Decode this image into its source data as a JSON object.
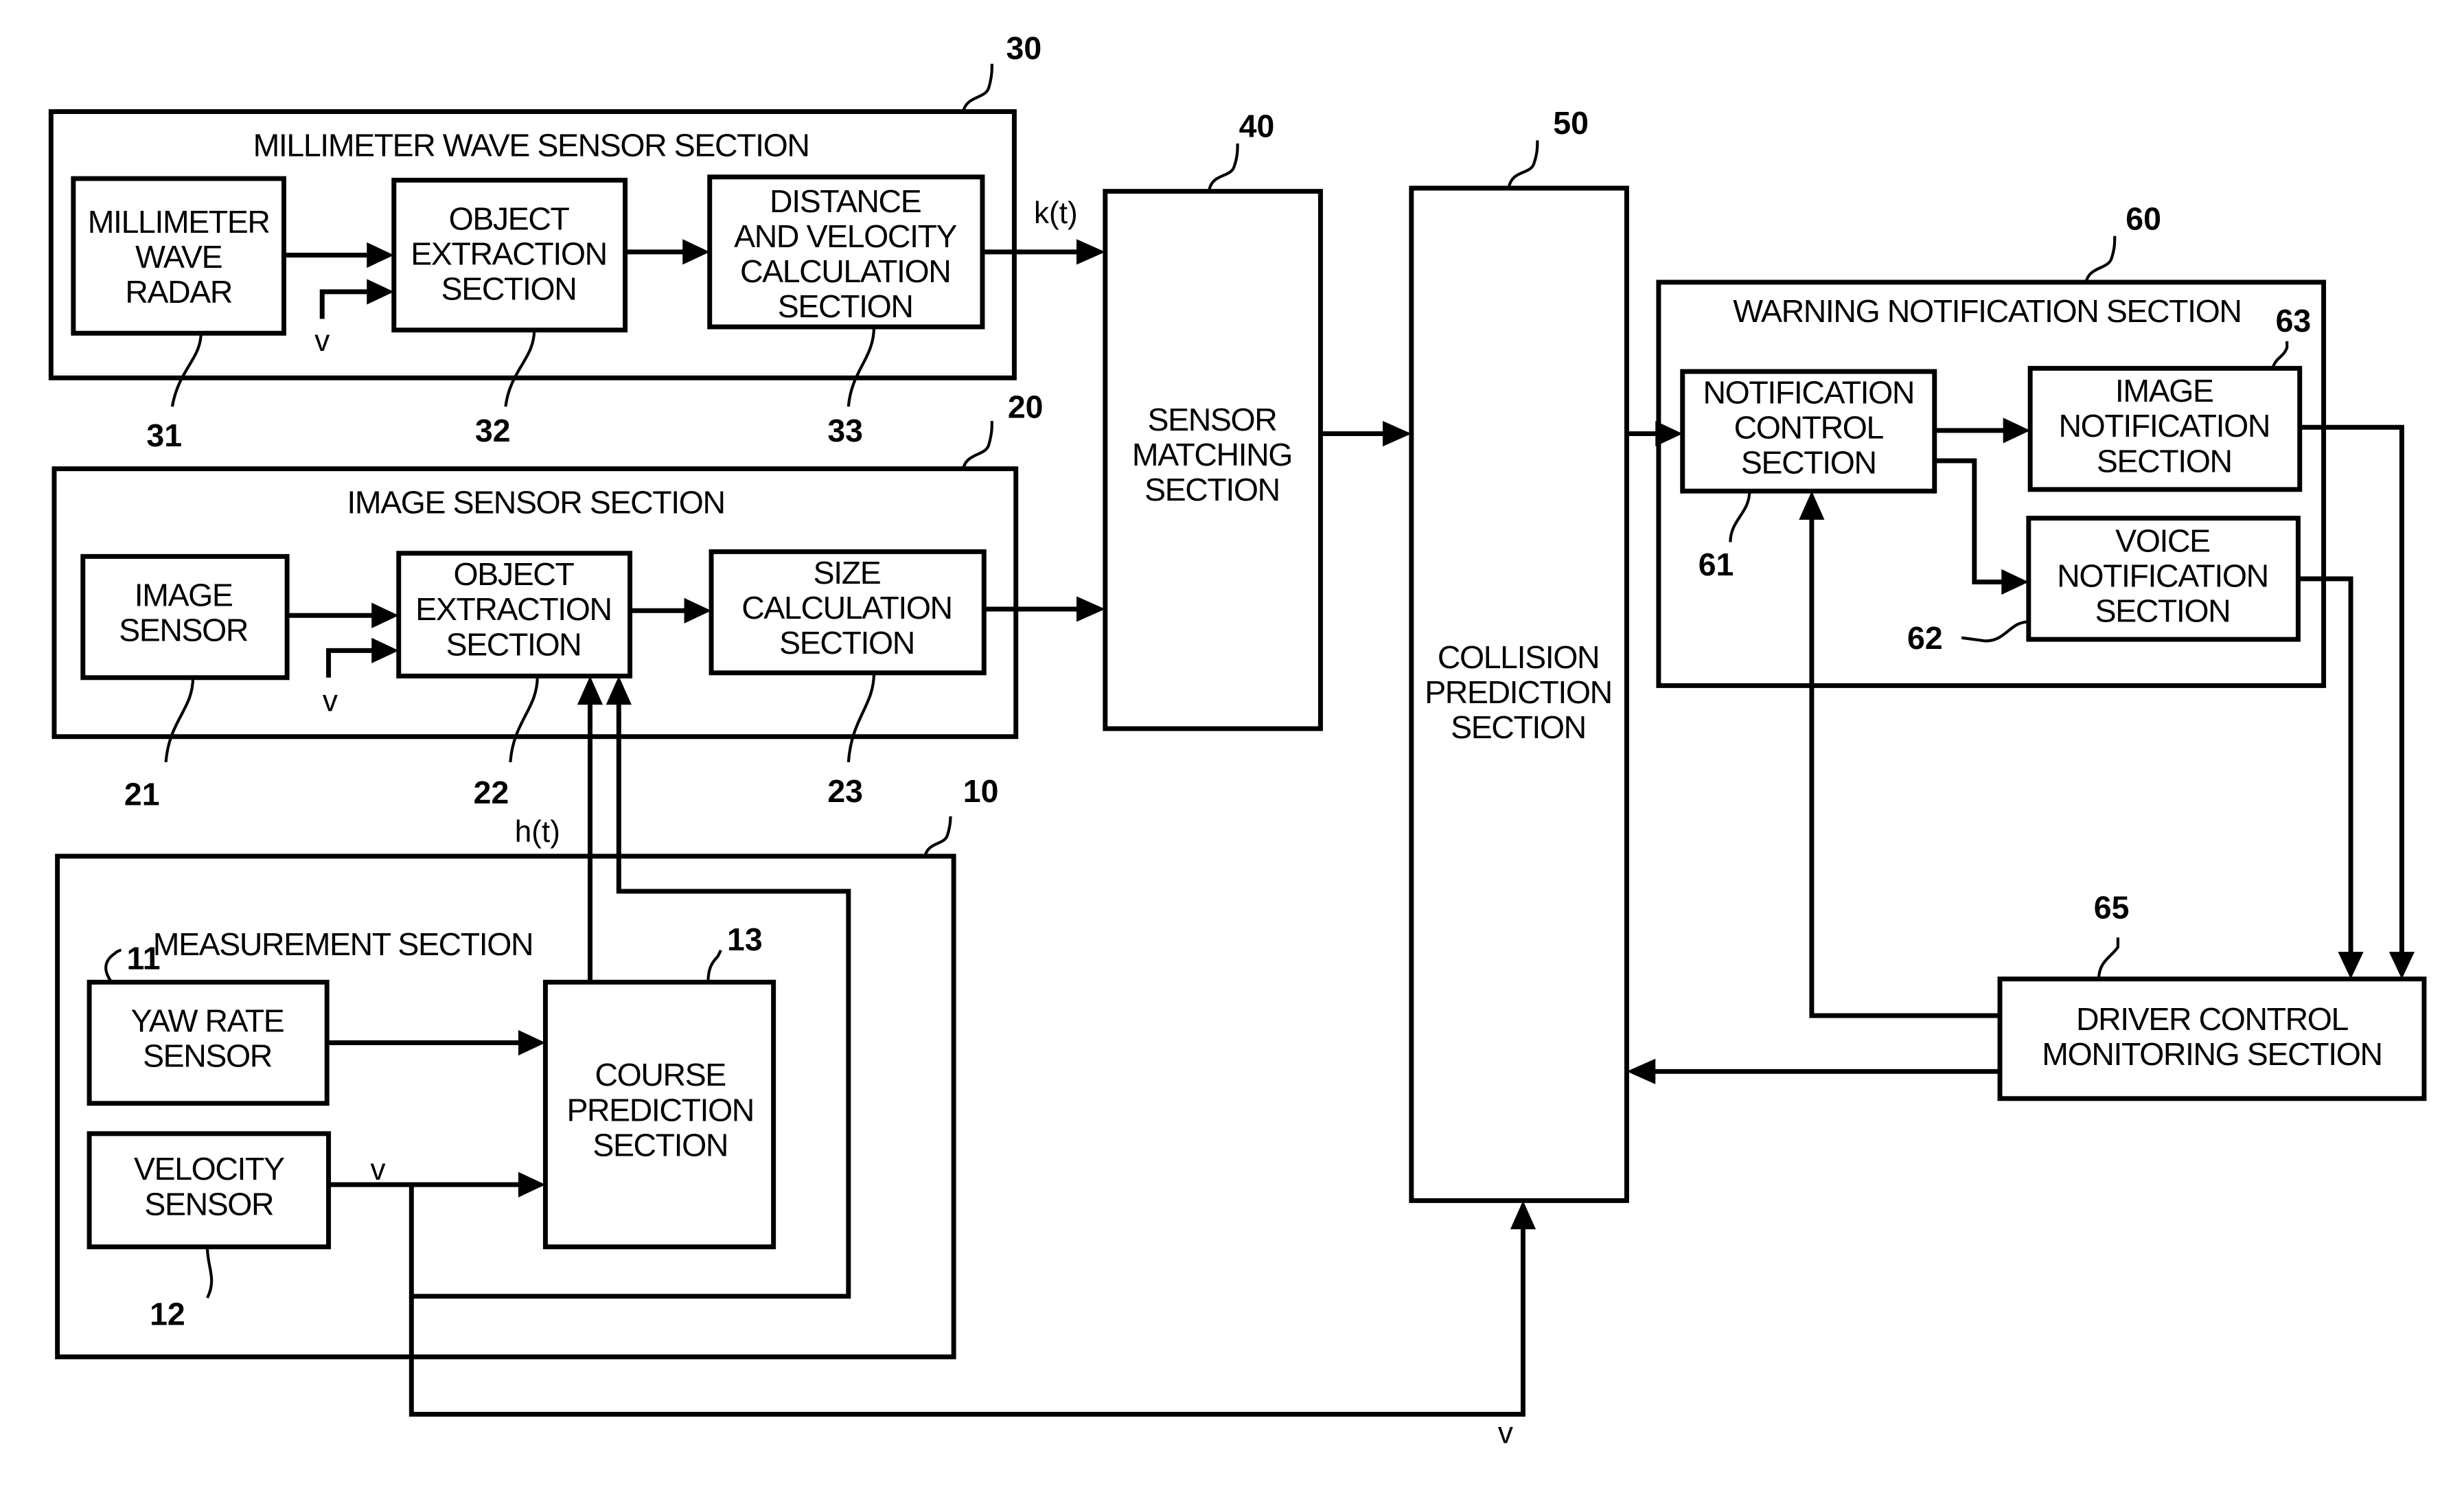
{
  "diagram": {
    "type": "block-diagram",
    "sections": {
      "millimeter_wave": {
        "ref": "30",
        "title": "MILLIMETER WAVE SENSOR SECTION",
        "blocks": {
          "radar": {
            "ref": "31",
            "lines": [
              "MILLIMETER",
              "WAVE",
              "RADAR"
            ]
          },
          "object_extraction": {
            "ref": "32",
            "lines": [
              "OBJECT",
              "EXTRACTION",
              "SECTION"
            ]
          },
          "distance_velocity": {
            "ref": "33",
            "lines": [
              "DISTANCE",
              "AND VELOCITY",
              "CALCULATION",
              "SECTION"
            ]
          }
        },
        "input_signal": "v",
        "output_signal": "k(t)"
      },
      "image_sensor": {
        "ref": "20",
        "title": "IMAGE SENSOR SECTION",
        "blocks": {
          "image_sensor": {
            "ref": "21",
            "lines": [
              "IMAGE",
              "SENSOR"
            ]
          },
          "object_extraction": {
            "ref": "22",
            "lines": [
              "OBJECT",
              "EXTRACTION",
              "SECTION"
            ]
          },
          "size_calculation": {
            "ref": "23",
            "lines": [
              "SIZE",
              "CALCULATION",
              "SECTION"
            ]
          }
        },
        "input_signal": "v"
      },
      "measurement": {
        "ref": "10",
        "title": "MEASUREMENT SECTION",
        "blocks": {
          "yaw_rate": {
            "ref": "11",
            "lines": [
              "YAW RATE",
              "SENSOR"
            ]
          },
          "velocity": {
            "ref": "12",
            "lines": [
              "VELOCITY",
              "SENSOR"
            ]
          },
          "course_prediction": {
            "ref": "13",
            "lines": [
              "COURSE",
              "PREDICTION",
              "SECTION"
            ]
          }
        },
        "output_signal": "h(t)",
        "velocity_signal": "v"
      },
      "sensor_matching": {
        "ref": "40",
        "lines": [
          "SENSOR",
          "MATCHING",
          "SECTION"
        ]
      },
      "collision_prediction": {
        "ref": "50",
        "lines": [
          "COLLISION",
          "PREDICTION",
          "SECTION"
        ],
        "input_signal": "v"
      },
      "warning_notification": {
        "ref": "60",
        "title": "WARNING NOTIFICATION SECTION",
        "blocks": {
          "notification_control": {
            "ref": "61",
            "lines": [
              "NOTIFICATION",
              "CONTROL",
              "SECTION"
            ]
          },
          "voice_notification": {
            "ref": "62",
            "lines": [
              "VOICE",
              "NOTIFICATION",
              "SECTION"
            ]
          },
          "image_notification": {
            "ref": "63",
            "lines": [
              "IMAGE",
              "NOTIFICATION",
              "SECTION"
            ]
          }
        }
      },
      "driver_control_monitoring": {
        "ref": "65",
        "lines": [
          "DRIVER CONTROL",
          "MONITORING SECTION"
        ]
      }
    }
  }
}
